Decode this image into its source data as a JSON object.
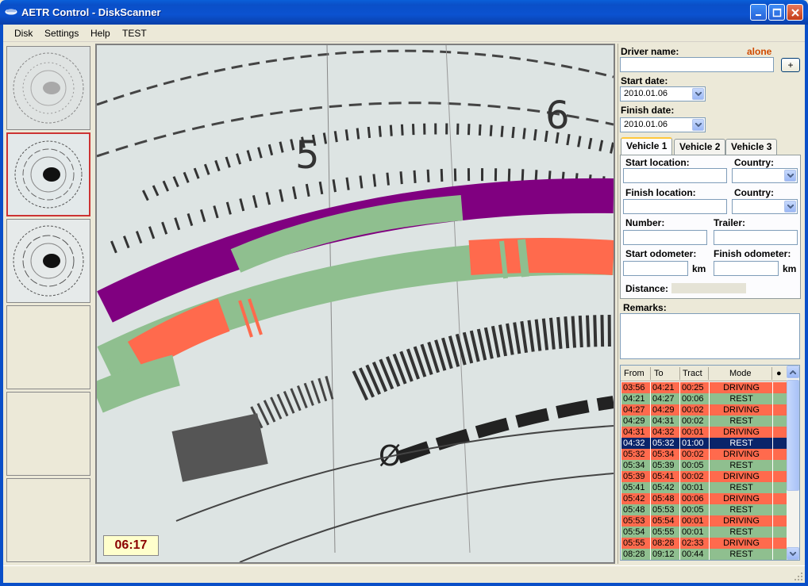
{
  "window": {
    "title": "AETR Control - DiskScanner"
  },
  "menu": [
    "Disk",
    "Settings",
    "Help",
    "TEST"
  ],
  "scan": {
    "time": "06:17"
  },
  "driver": {
    "label": "Driver name:",
    "status": "alone",
    "value": "",
    "add_label": "+"
  },
  "start_date": {
    "label": "Start date:",
    "value": "2010.01.06"
  },
  "finish_date": {
    "label": "Finish date:",
    "value": "2010.01.06"
  },
  "tabs": [
    "Vehicle 1",
    "Vehicle 2",
    "Vehicle 3"
  ],
  "vehicle": {
    "start_location": "Start location:",
    "country1": "Country:",
    "finish_location": "Finish location:",
    "country2": "Country:",
    "number": "Number:",
    "trailer": "Trailer:",
    "start_odometer": "Start odometer:",
    "finish_odometer": "Finish odometer:",
    "km1": "km",
    "km2": "km",
    "distance": "Distance:"
  },
  "remarks": {
    "label": "Remarks:"
  },
  "grid": {
    "headers": [
      "From",
      "To",
      "Tract",
      "Mode",
      "●"
    ],
    "rows": [
      {
        "from": "03:56",
        "to": "04:21",
        "tract": "00:25",
        "mode": "DRIVING",
        "kind": "r"
      },
      {
        "from": "04:21",
        "to": "04:27",
        "tract": "00:06",
        "mode": "REST",
        "kind": "g"
      },
      {
        "from": "04:27",
        "to": "04:29",
        "tract": "00:02",
        "mode": "DRIVING",
        "kind": "r"
      },
      {
        "from": "04:29",
        "to": "04:31",
        "tract": "00:02",
        "mode": "REST",
        "kind": "g"
      },
      {
        "from": "04:31",
        "to": "04:32",
        "tract": "00:01",
        "mode": "DRIVING",
        "kind": "r"
      },
      {
        "from": "04:32",
        "to": "05:32",
        "tract": "01:00",
        "mode": "REST",
        "kind": "sel"
      },
      {
        "from": "05:32",
        "to": "05:34",
        "tract": "00:02",
        "mode": "DRIVING",
        "kind": "r"
      },
      {
        "from": "05:34",
        "to": "05:39",
        "tract": "00:05",
        "mode": "REST",
        "kind": "g"
      },
      {
        "from": "05:39",
        "to": "05:41",
        "tract": "00:02",
        "mode": "DRIVING",
        "kind": "r"
      },
      {
        "from": "05:41",
        "to": "05:42",
        "tract": "00:01",
        "mode": "REST",
        "kind": "g"
      },
      {
        "from": "05:42",
        "to": "05:48",
        "tract": "00:06",
        "mode": "DRIVING",
        "kind": "r"
      },
      {
        "from": "05:48",
        "to": "05:53",
        "tract": "00:05",
        "mode": "REST",
        "kind": "g"
      },
      {
        "from": "05:53",
        "to": "05:54",
        "tract": "00:01",
        "mode": "DRIVING",
        "kind": "r"
      },
      {
        "from": "05:54",
        "to": "05:55",
        "tract": "00:01",
        "mode": "REST",
        "kind": "g"
      },
      {
        "from": "05:55",
        "to": "08:28",
        "tract": "02:33",
        "mode": "DRIVING",
        "kind": "r"
      },
      {
        "from": "08:28",
        "to": "09:12",
        "tract": "00:44",
        "mode": "REST",
        "kind": "g"
      }
    ]
  },
  "colors": {
    "driving": "#ff6a4d",
    "rest": "#8fbf8f",
    "selected": "#0a246a"
  }
}
